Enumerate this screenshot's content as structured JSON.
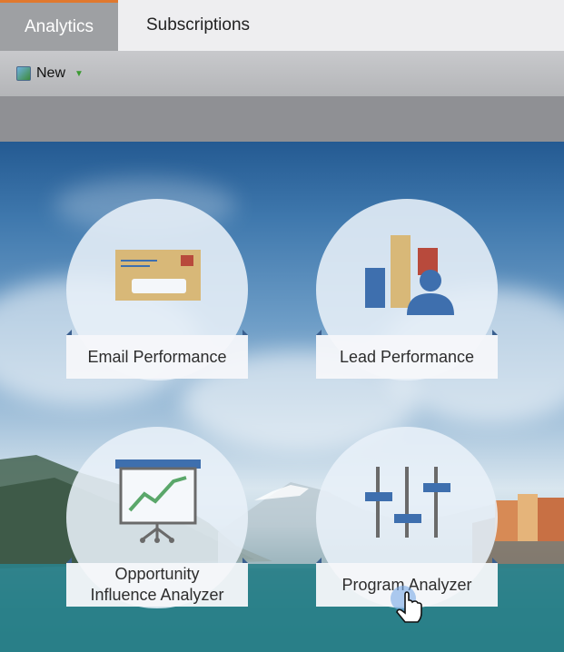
{
  "tabs": [
    {
      "label": "Analytics",
      "active": true
    },
    {
      "label": "Subscriptions",
      "active": false
    }
  ],
  "toolbar": {
    "new_label": "New"
  },
  "cards": [
    {
      "label": "Email Performance",
      "icon": "envelope-icon"
    },
    {
      "label": "Lead Performance",
      "icon": "lead-chart-icon"
    },
    {
      "label_line1": "Opportunity",
      "label_line2": "Influence Analyzer",
      "icon": "presentation-chart-icon"
    },
    {
      "label": "Program Analyzer",
      "icon": "sliders-icon"
    }
  ],
  "colors": {
    "tab_accent": "#e0782e",
    "icon_blue": "#3e6fae",
    "icon_tan": "#d8b878",
    "icon_red": "#b84a3c",
    "icon_green": "#5aa76a"
  }
}
